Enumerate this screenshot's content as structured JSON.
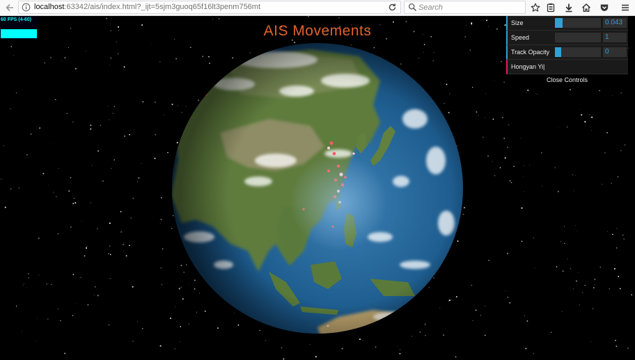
{
  "browser": {
    "url_host": "localhost",
    "url_rest": ":63342/ais/index.html?_ijt=5sjm3guoq65f16lt3penm756mt",
    "search_placeholder": "Search"
  },
  "page": {
    "title": "AIS Movements"
  },
  "fps": {
    "label": "60 FPS (4-60)"
  },
  "controls": {
    "size": {
      "label": "Size",
      "value": "0.043",
      "fraction": 0.16
    },
    "speed": {
      "label": "Speed",
      "value": "1",
      "fraction": 0.0
    },
    "track_opacity": {
      "label": "Track Opacity",
      "value": "0",
      "fraction": 0.14
    },
    "name_field": {
      "value": "Hongyan Yi|"
    },
    "close_label": "Close Controls"
  },
  "colors": {
    "title": "#e0622a",
    "gui_number": "#2fa1d6",
    "gui_string": "#e61d5f",
    "fps_graph": "#00ffff",
    "ocean": "#1f5a8a",
    "land": "#5c7a3a"
  },
  "icons": [
    "back-arrow-icon",
    "info-icon",
    "reload-icon",
    "search-icon",
    "star-icon",
    "reading-list-icon",
    "download-icon",
    "home-icon",
    "pocket-icon",
    "menu-icon"
  ]
}
